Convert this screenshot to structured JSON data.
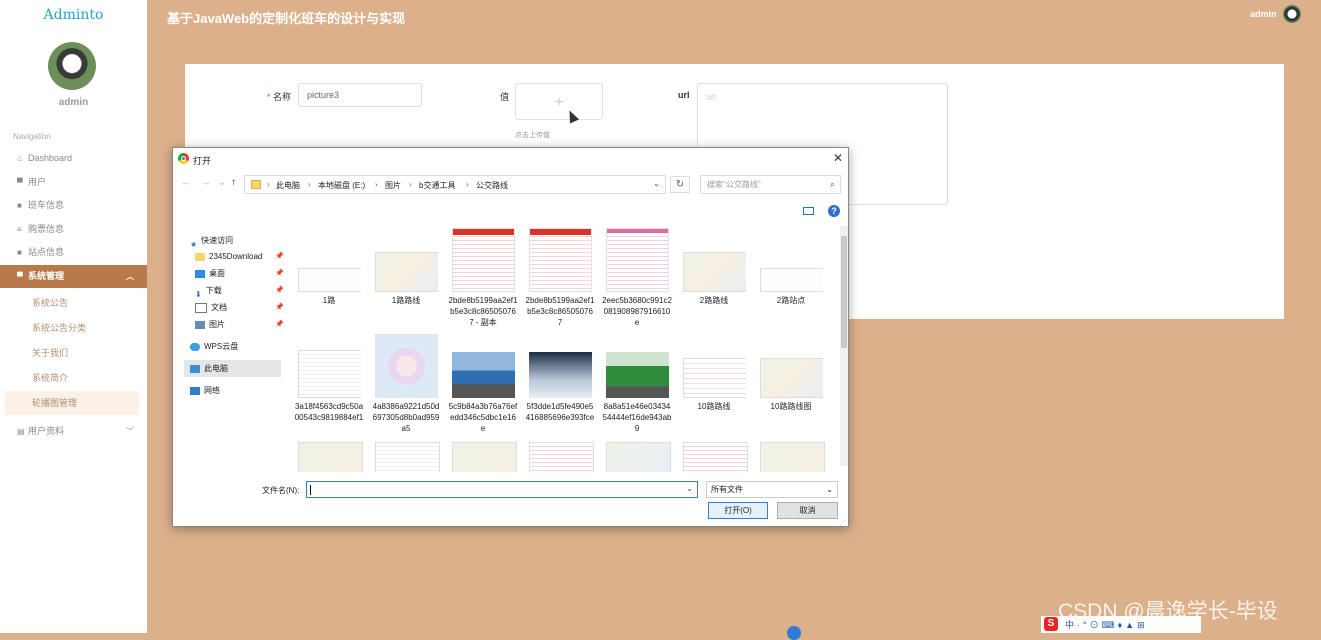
{
  "brand": "Adminto",
  "sidebar": {
    "user_name": "admin",
    "nav_heading": "Navigation",
    "items": [
      {
        "icon": "home-icon",
        "glyph": "⌂",
        "label": "Dashboard"
      },
      {
        "icon": "user-icon",
        "glyph": "▀",
        "label": "用户"
      },
      {
        "icon": "grid-icon",
        "glyph": "■",
        "label": "班车信息"
      },
      {
        "icon": "list-icon",
        "glyph": "≡",
        "label": "购票信息"
      },
      {
        "icon": "grid-icon",
        "glyph": "■",
        "label": "站点信息"
      },
      {
        "icon": "user-icon",
        "glyph": "▀",
        "label": "系统管理"
      },
      {
        "icon": "doc-icon",
        "glyph": "▤",
        "label": "用户资料"
      }
    ],
    "submenu": [
      "系统公告",
      "系统公告分类",
      "关于我们",
      "系统简介",
      "轮播图管理"
    ]
  },
  "header": {
    "title": "基于JavaWeb的定制化班车的设计与实现",
    "user": "admin"
  },
  "form": {
    "name_required_mark": "*",
    "name_label": "名称",
    "name_value": "picture3",
    "value_label": "值",
    "upload_plus": "+",
    "upload_hint": "点击上传值",
    "url_label": "url",
    "url_placeholder": "url"
  },
  "dialog": {
    "title": "打开",
    "close": "✕",
    "nav_back": "←",
    "nav_forward": "→",
    "nav_down": "⌄",
    "nav_up": "↑",
    "breadcrumbs": [
      "此电脑",
      "本地磁盘 (E:)",
      "图片",
      "b交通工具",
      "公交路线"
    ],
    "breadcrumb_sep": "›",
    "addr_dropdown": "⌄",
    "refresh": "↻",
    "search_placeholder": "搜索\"公交路线\"",
    "search_glyph": "⌕",
    "help_glyph": "?",
    "tree": [
      {
        "label": "快速访问",
        "pinned": false
      },
      {
        "label": "2345Download",
        "pinned": true
      },
      {
        "label": "桌面",
        "pinned": true
      },
      {
        "label": "下载",
        "pinned": true
      },
      {
        "label": "文档",
        "pinned": true
      },
      {
        "label": "图片",
        "pinned": true
      },
      {
        "label": "WPS云盘",
        "pinned": false
      },
      {
        "label": "此电脑",
        "pinned": false
      },
      {
        "label": "网络",
        "pinned": false
      }
    ],
    "pin_glyph": "📌",
    "files": [
      "1路",
      "1路路线",
      "2bde8b5199aa2ef1b5e3c8c865050767 - 副本",
      "2bde8b5199aa2ef1b5e3c8c865050767",
      "2eec5b3680c991c2081908987916610e",
      "2路路线",
      "2路站点",
      "3a18f4563cd9c50a00543c9819884ef1",
      "4a8386a9221d50d697305d8b0ad959a5",
      "5c9b84a3b76a76efedd346c5dbc1e16e",
      "5f3dde1d5fe490e5416885696e393fce",
      "8a8a51e46e0343454444ef16de943ab9",
      "10路路线",
      "10路路线图",
      "",
      "",
      "",
      "",
      "",
      "",
      ""
    ],
    "filename_label": "文件名(N):",
    "filename_value": "",
    "filter_value": "所有文件",
    "open_label": "打开(O)",
    "cancel_label": "取消"
  },
  "watermark": "CSDN @晨逸学长-毕设",
  "ime": {
    "logo": "S",
    "text": "中·°⊙⌨♦▲⊞"
  },
  "colors": {
    "sidebar_active": "#b87a4b",
    "page_bg": "#dcb08b",
    "brand": "#1fa5c9"
  }
}
